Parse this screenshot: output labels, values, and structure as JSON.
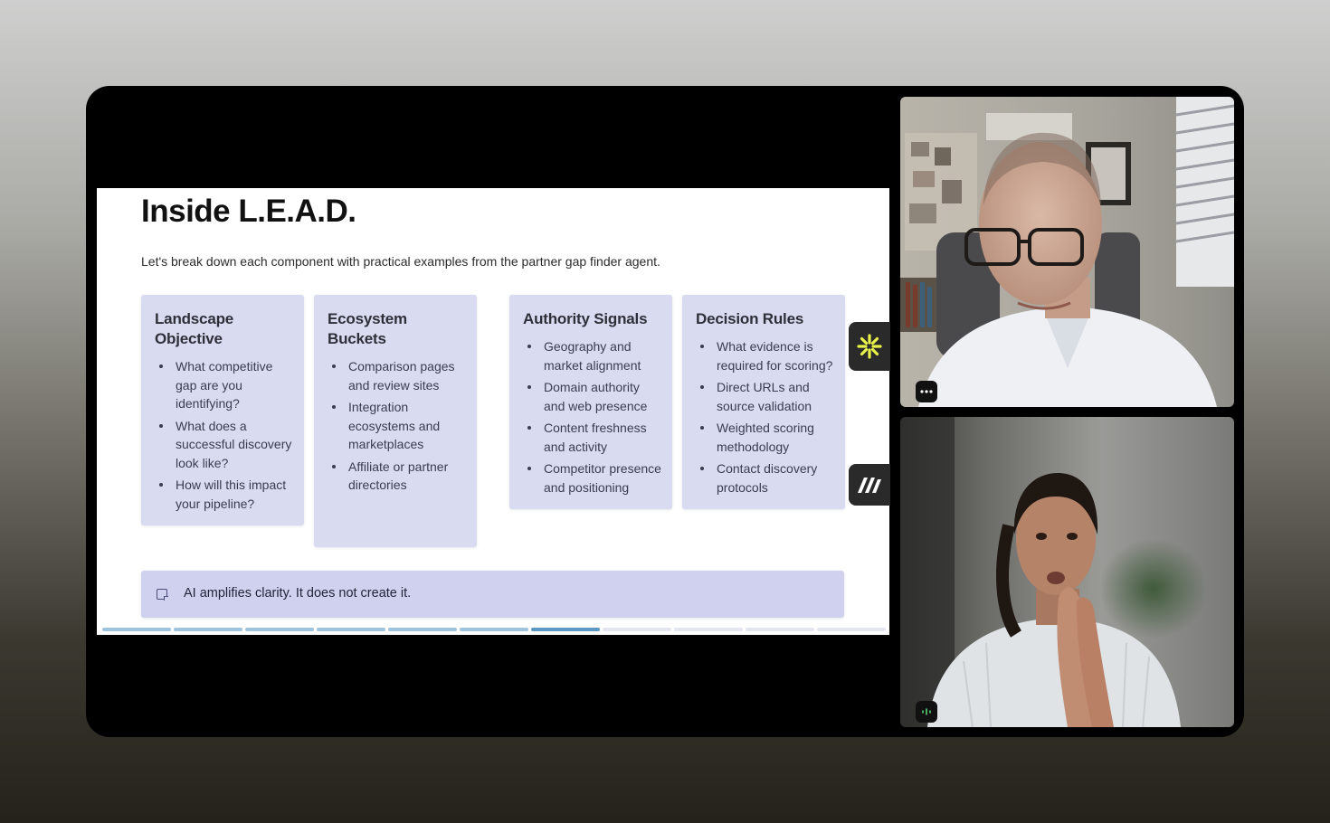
{
  "slide": {
    "title": "Inside L.E.A.D.",
    "subtitle": "Let's break down each component with practical examples from the partner gap finder agent.",
    "cards": [
      {
        "title": "Landscape Objective",
        "bullets": [
          "What competitive gap are you identifying?",
          "What does a successful discovery look like?",
          "How will this impact your pipeline?"
        ]
      },
      {
        "title": "Ecosystem Buckets",
        "bullets": [
          "Comparison pages and review sites",
          "Integration ecosystems and marketplaces",
          "Affiliate or partner directories"
        ]
      },
      {
        "title": "Authority Signals",
        "bullets": [
          "Geography and market alignment",
          "Domain authority and web presence",
          "Content freshness and activity",
          "Competitor presence and positioning"
        ]
      },
      {
        "title": "Decision Rules",
        "bullets": [
          "What evidence is required for scoring?",
          "Direct URLs and source validation",
          "Weighted scoring methodology",
          "Contact discovery protocols"
        ]
      }
    ],
    "callout": "AI amplifies clarity. It does not create it.",
    "progress": {
      "segments": 11,
      "completed": 6,
      "current": 7
    }
  },
  "side_buttons": [
    {
      "icon": "yellow-sparkle-app-icon"
    },
    {
      "icon": "miro-app-icon"
    }
  ],
  "participants": [
    {
      "tile": "man-in-white-shirt-with-glasses",
      "badge_icon": "more-options-icon"
    },
    {
      "tile": "woman-in-light-sweater",
      "badge_icon": "audio-level-icon"
    }
  ],
  "colors": {
    "card_bg": "#d9dcf0",
    "callout_bg": "#cfd1ee",
    "progress_active": "#5b98c4",
    "sparkle_yellow": "#e8f04a"
  }
}
